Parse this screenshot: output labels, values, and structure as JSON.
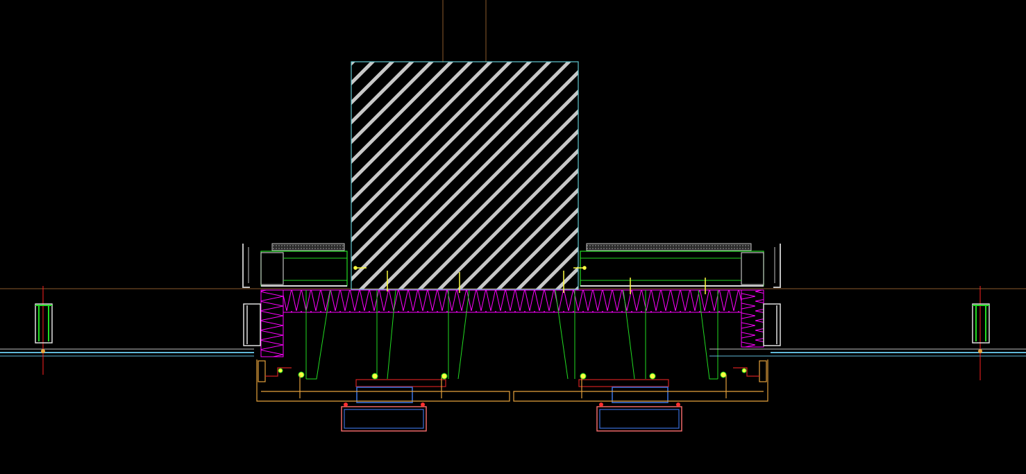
{
  "drawing": {
    "kind": "cad-section-detail",
    "background": "#000000",
    "layers": {
      "axis": "#8b5a2b",
      "column_outline": "#5fc8d0",
      "hatch": "#c8c8c8",
      "insulation": "#ff00ff",
      "steel": "#22dd22",
      "panel": "#c0c0c0",
      "glass": "#5fb8d8",
      "trim": "#e6a23c",
      "gutter": "#ff7070",
      "channel": "#3a6fd8",
      "flashing": "#d02020",
      "bolt": "#ffff40",
      "grid_line": "#ff2020"
    }
  }
}
